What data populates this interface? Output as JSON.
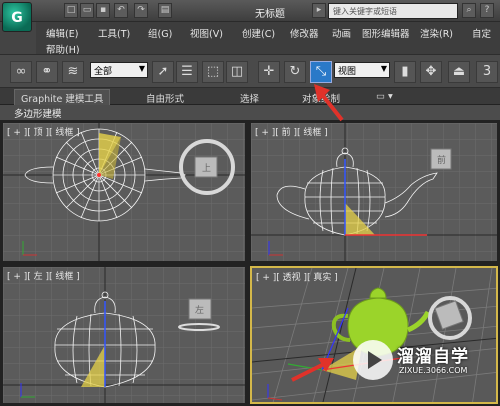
{
  "app": {
    "logo_text": "G",
    "title": "无标题"
  },
  "search": {
    "placeholder": "键入关键字或短语"
  },
  "menu": [
    "编辑(E)",
    "工具(T)",
    "组(G)",
    "视图(V)",
    "创建(C)",
    "修改器",
    "动画",
    "图形编辑器",
    "渲染(R)",
    "自定",
    "帮助(H)"
  ],
  "toolbar": {
    "selection_filter": "全部",
    "ref_coord": "视图",
    "icons": [
      "link-icon",
      "unlink-icon",
      "bind-spacewarp-icon",
      "select-icon",
      "select-by-name-icon",
      "rect-region-icon",
      "window-crossing-icon",
      "move-icon",
      "rotate-icon",
      "scale-icon",
      "pivot-icon",
      "manipulate-icon",
      "mirror-icon"
    ]
  },
  "ribbon": {
    "tabs": [
      "Graphite 建模工具",
      "自由形式",
      "选择",
      "对象绘制"
    ],
    "sub": "多边形建模"
  },
  "viewports": [
    {
      "label": "[ + ][ 顶 ][ 线框 ]",
      "cube": "上"
    },
    {
      "label": "[ + ][ 前 ][ 线框 ]",
      "cube": "前"
    },
    {
      "label": "[ + ][ 左 ][ 线框 ]",
      "cube": "左"
    },
    {
      "label": "[ + ][ 透视 ][ 真实 ]",
      "cube": ""
    }
  ],
  "watermark": {
    "name": "溜溜自学",
    "url": "ZIXUE.3066.COM"
  },
  "colors": {
    "accent": "#2a79c8",
    "viewport_bg": "#5b5b5b",
    "active_border": "#d4b84a",
    "gizmo": "#e6d24a",
    "teapot_persp": "#9bd42a",
    "arrow": "#e0322a"
  }
}
